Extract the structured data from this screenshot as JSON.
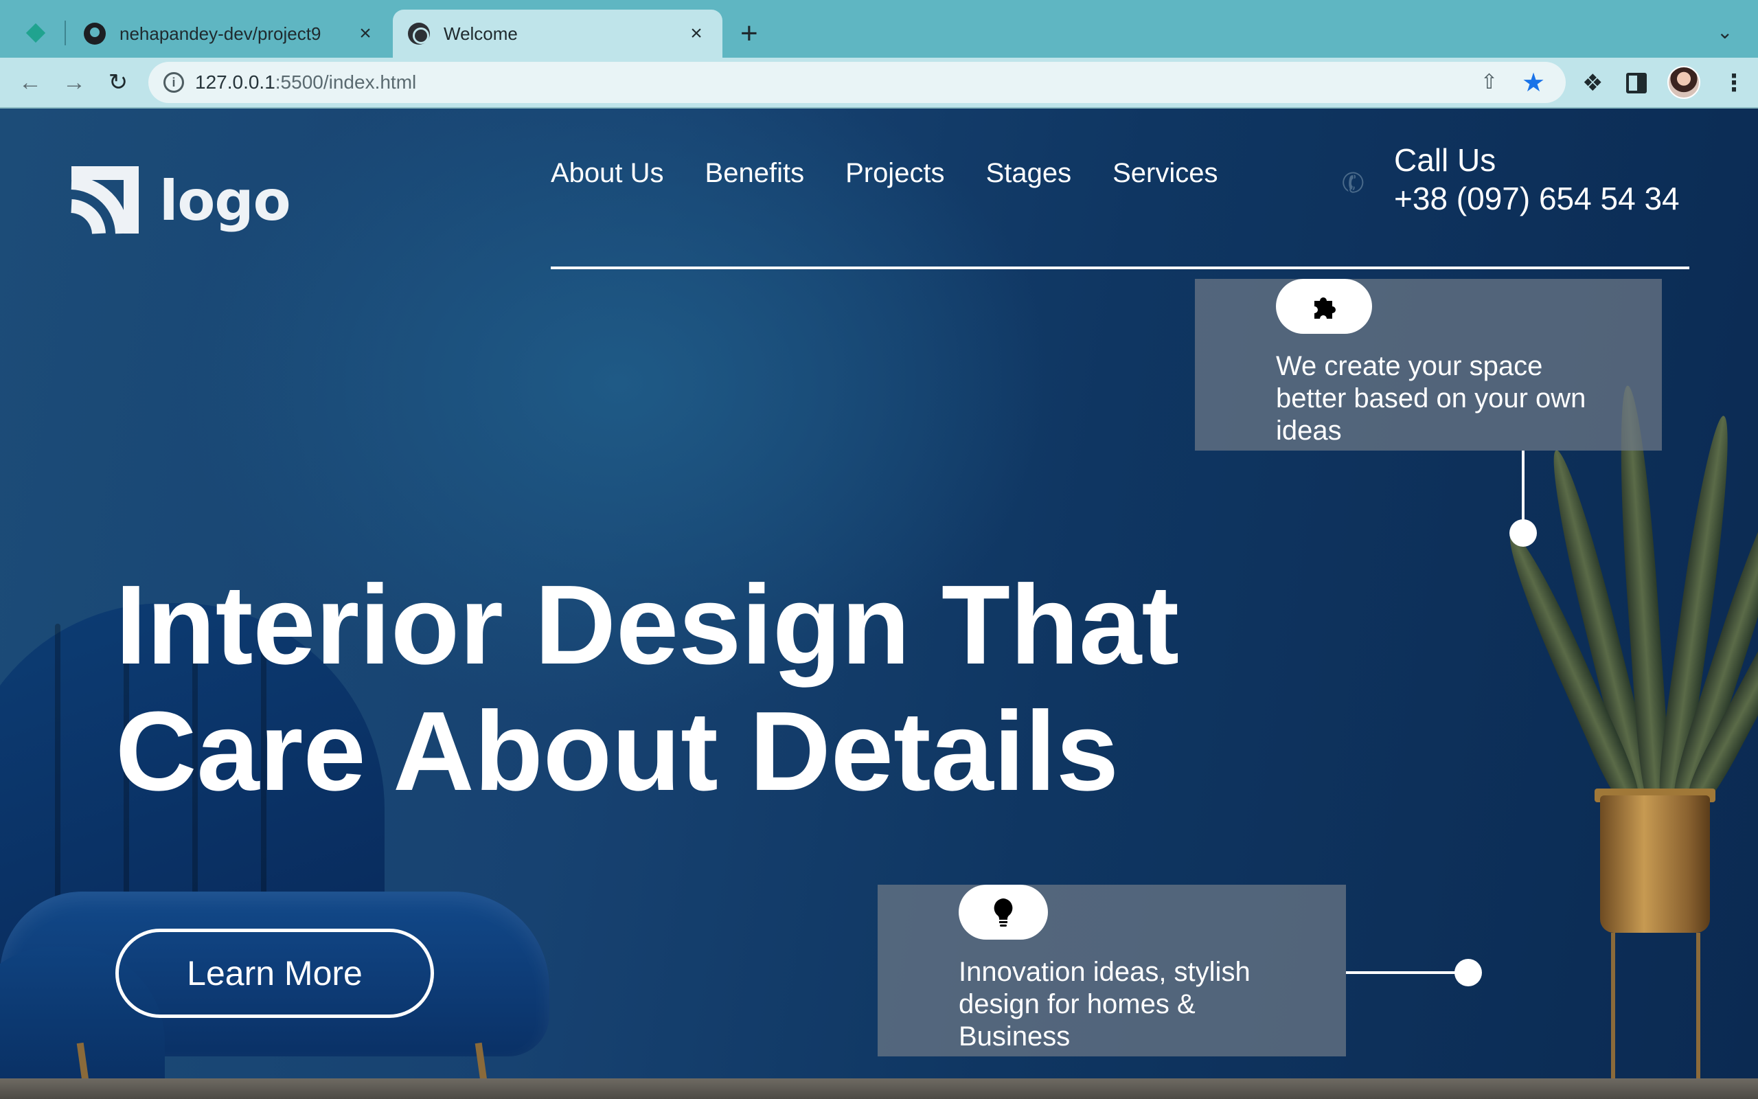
{
  "browser": {
    "tabs": [
      {
        "title": "nehapandey-dev/project9",
        "active": false
      },
      {
        "title": "Welcome",
        "active": true
      }
    ],
    "new_tab": "+",
    "close": "×",
    "url_host": "127.0.0.1",
    "url_rest": ":5500/index.html"
  },
  "site": {
    "logo_text": "logo",
    "nav": [
      "About Us",
      "Benefits",
      "Projects",
      "Stages",
      "Services"
    ],
    "call_label": "Call Us",
    "call_number": "+38 (097) 654 54 34",
    "hero_line1": "Interior Design That",
    "hero_line2": "Care About Details",
    "learn_more": "Learn More",
    "features": [
      {
        "icon": "puzzle-icon",
        "text": "We create your space better based on your own ideas"
      },
      {
        "icon": "lightbulb-icon",
        "text": "Innovation ideas, stylish design for homes & Business"
      }
    ]
  },
  "colors": {
    "tabbar": "#5fb6c2",
    "toolbar": "#bfe4ea",
    "accent_star": "#1a73e8",
    "page_bg": "#174271",
    "card_bg": "#6e7887"
  }
}
